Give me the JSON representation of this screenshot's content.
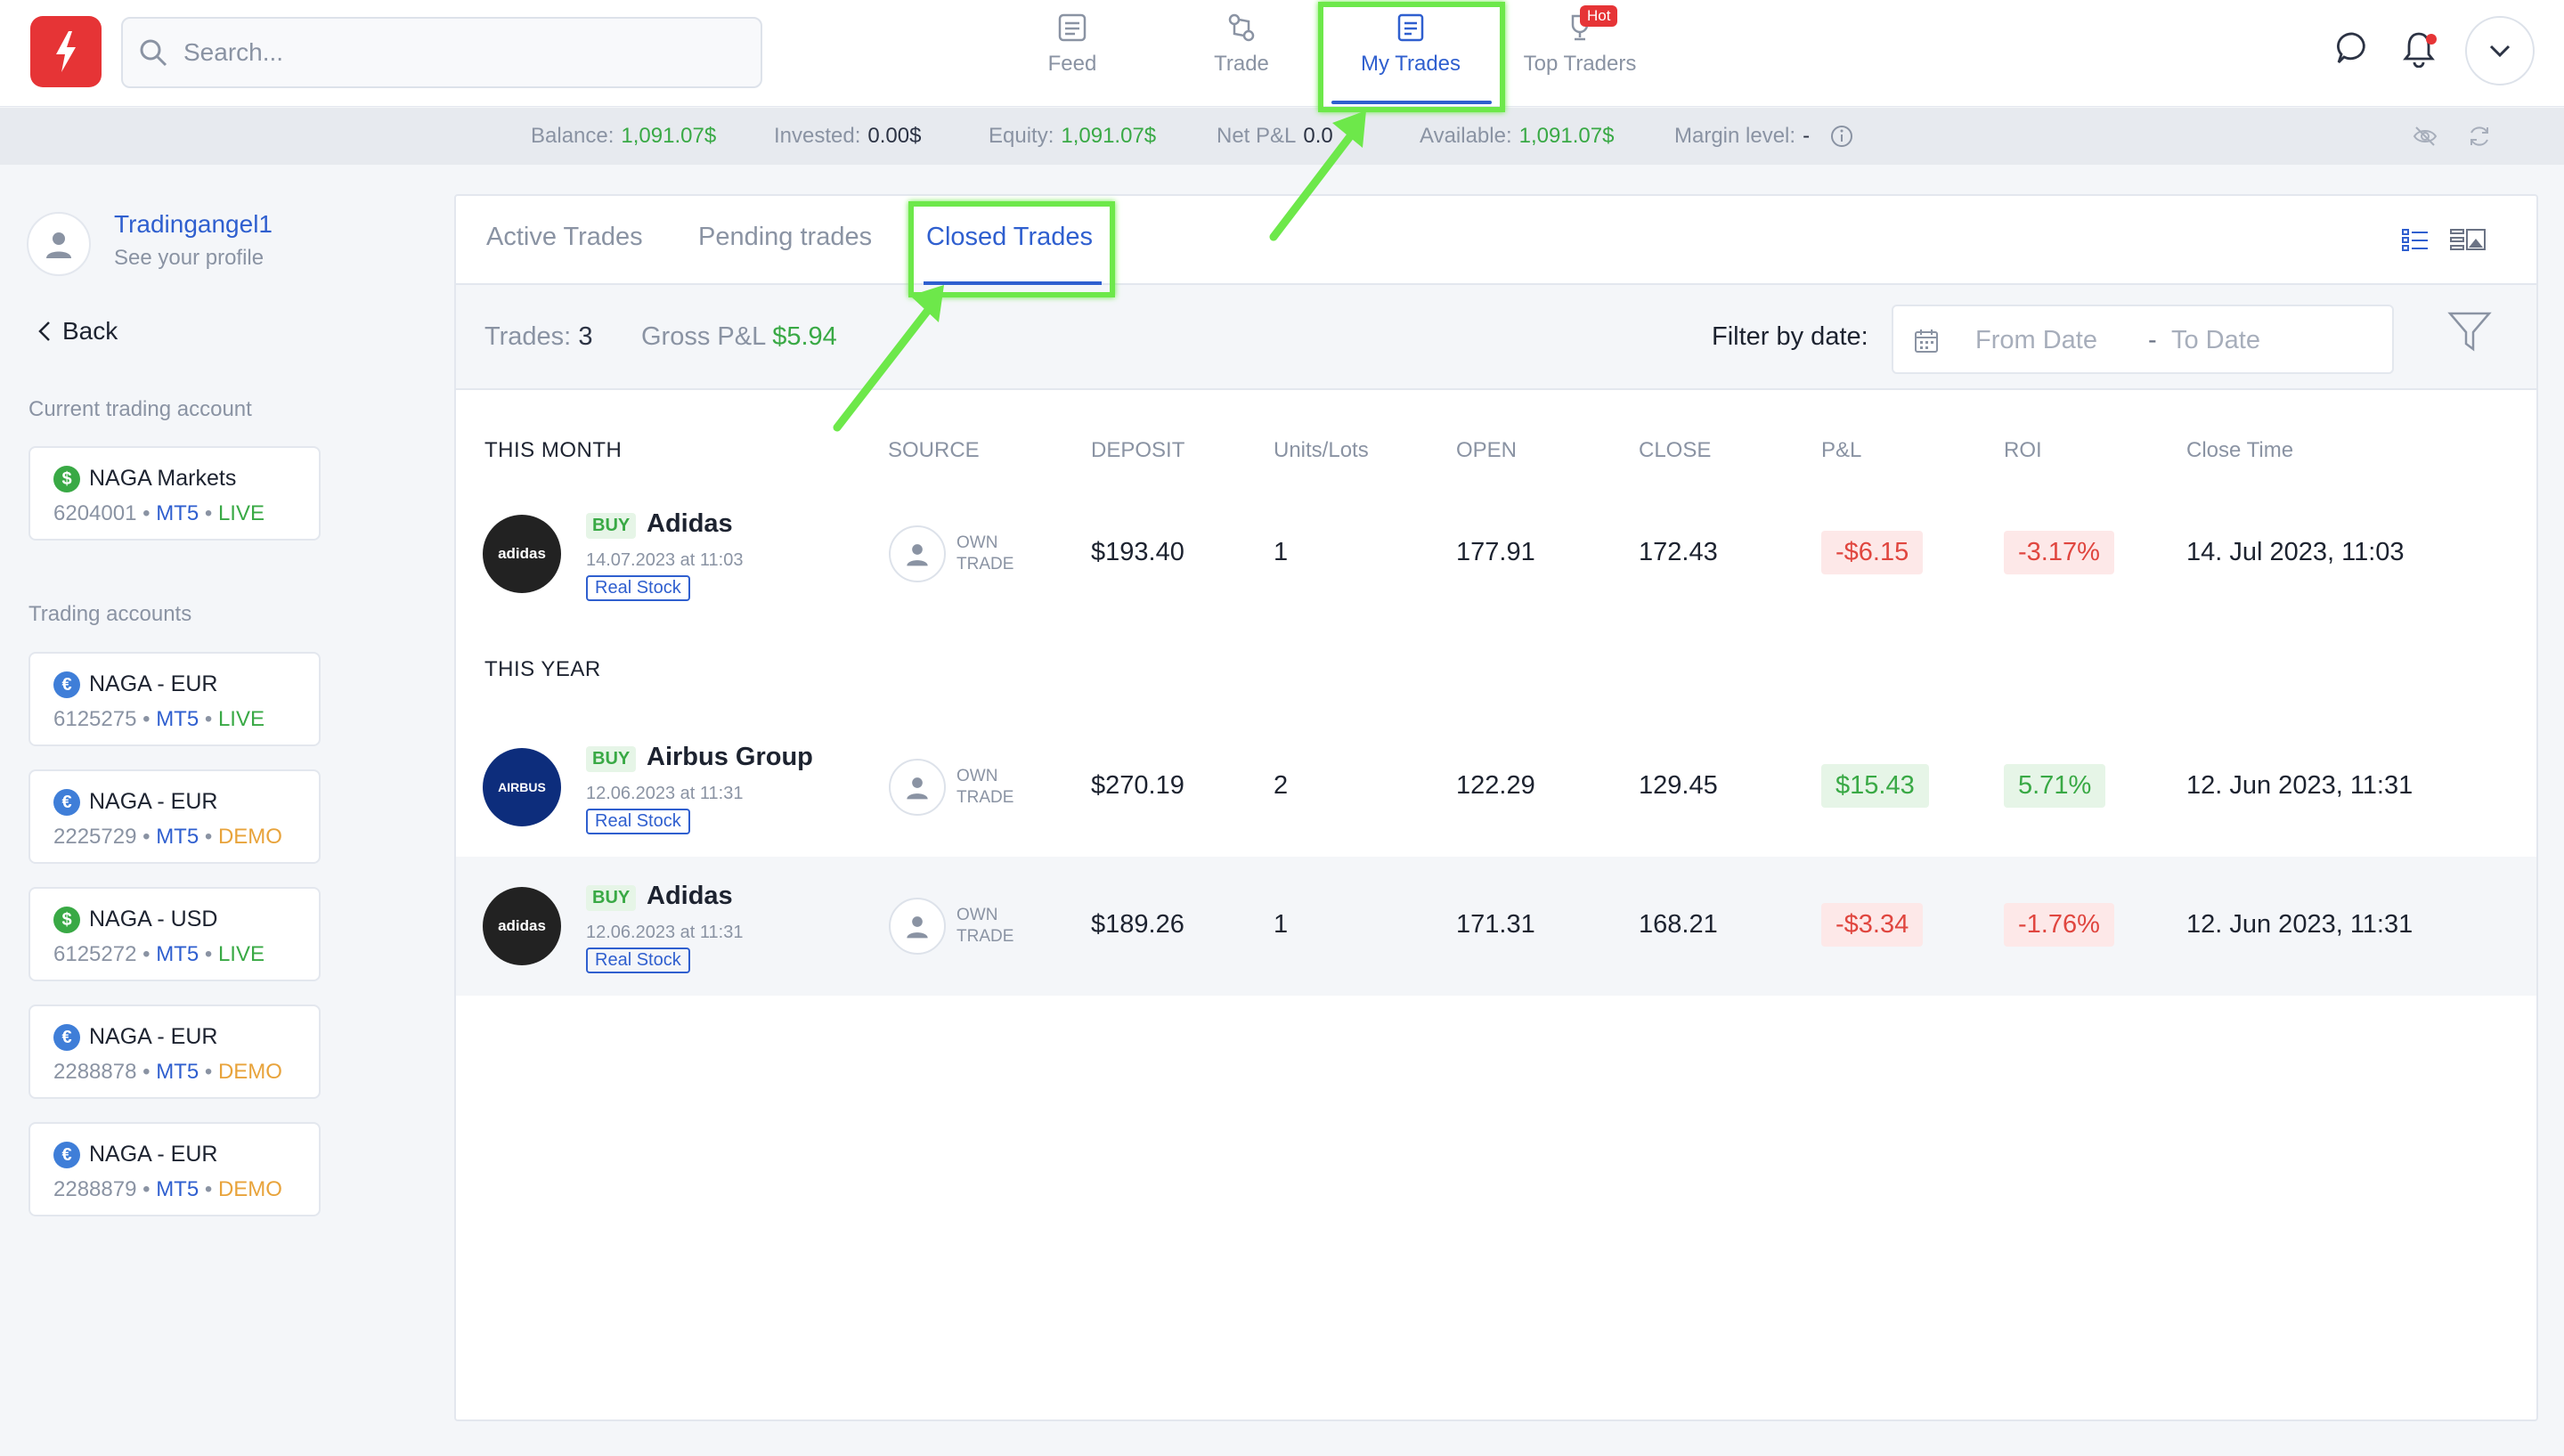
{
  "search": {
    "placeholder": "Search..."
  },
  "nav": {
    "items": [
      {
        "label": "Feed",
        "icon": "feed-icon"
      },
      {
        "label": "Trade",
        "icon": "trade-icon"
      },
      {
        "label": "My Trades",
        "icon": "my-trades-icon"
      },
      {
        "label": "Top Traders",
        "icon": "trophy-icon"
      }
    ],
    "active": "My Trades",
    "hot_badge": "Hot"
  },
  "stats": {
    "balance_label": "Balance:",
    "balance": "1,091.07$",
    "invested_label": "Invested:",
    "invested": "0.00$",
    "equity_label": "Equity:",
    "equity": "1,091.07$",
    "netpl_label": "Net P&L",
    "netpl": "0.0",
    "available_label": "Available:",
    "available": "1,091.07$",
    "margin_label": "Margin level:",
    "margin": "-"
  },
  "profile": {
    "name": "Tradingangel1",
    "subtitle": "See your profile"
  },
  "back_label": "Back",
  "current_account": {
    "title": "Current trading account",
    "name": "NAGA Markets",
    "number": "6204001",
    "platform": "MT5",
    "type": "LIVE",
    "currency_symbol": "$"
  },
  "accounts_title": "Trading accounts",
  "accounts": [
    {
      "name": "NAGA - EUR",
      "number": "6125275",
      "platform": "MT5",
      "type": "LIVE",
      "currency_symbol": "€"
    },
    {
      "name": "NAGA - EUR",
      "number": "2225729",
      "platform": "MT5",
      "type": "DEMO",
      "currency_symbol": "€"
    },
    {
      "name": "NAGA - USD",
      "number": "6125272",
      "platform": "MT5",
      "type": "LIVE",
      "currency_symbol": "$"
    },
    {
      "name": "NAGA - EUR",
      "number": "2288878",
      "platform": "MT5",
      "type": "DEMO",
      "currency_symbol": "€"
    },
    {
      "name": "NAGA - EUR",
      "number": "2288879",
      "platform": "MT5",
      "type": "DEMO",
      "currency_symbol": "€"
    }
  ],
  "tabs": {
    "active_trades": "Active Trades",
    "pending_trades": "Pending trades",
    "closed_trades": "Closed Trades"
  },
  "filter": {
    "trades_label": "Trades:",
    "trades_count": "3",
    "gross_label": "Gross P&L",
    "gross_value": "$5.94",
    "filter_label": "Filter by date:",
    "from_placeholder": "From Date",
    "separator": "-",
    "to_placeholder": "To Date"
  },
  "columns": {
    "this_month": "THIS MONTH",
    "source": "SOURCE",
    "deposit": "DEPOSIT",
    "units": "Units/Lots",
    "open": "OPEN",
    "close": "CLOSE",
    "pl": "P&L",
    "roi": "ROI",
    "close_time": "Close Time"
  },
  "this_year_label": "THIS YEAR",
  "trades": [
    {
      "brand_text": "adidas",
      "side": "BUY",
      "instrument": "Adidas",
      "date": "14.07.2023 at 11:03",
      "tag": "Real Stock",
      "source_line1": "OWN",
      "source_line2": "TRADE",
      "deposit": "$193.40",
      "units": "1",
      "open": "177.91",
      "close": "172.43",
      "pl": "-$6.15",
      "roi": "-3.17%",
      "close_time": "14. Jul 2023, 11:03",
      "positive": false
    },
    {
      "brand_text": "AIRBUS",
      "side": "BUY",
      "instrument": "Airbus Group",
      "date": "12.06.2023 at 11:31",
      "tag": "Real Stock",
      "source_line1": "OWN",
      "source_line2": "TRADE",
      "deposit": "$270.19",
      "units": "2",
      "open": "122.29",
      "close": "129.45",
      "pl": "$15.43",
      "roi": "5.71%",
      "close_time": "12. Jun 2023, 11:31",
      "positive": true
    },
    {
      "brand_text": "adidas",
      "side": "BUY",
      "instrument": "Adidas",
      "date": "12.06.2023 at 11:31",
      "tag": "Real Stock",
      "source_line1": "OWN",
      "source_line2": "TRADE",
      "deposit": "$189.26",
      "units": "1",
      "open": "171.31",
      "close": "168.21",
      "pl": "-$3.34",
      "roi": "-1.76%",
      "close_time": "12. Jun 2023, 11:31",
      "positive": false
    }
  ],
  "colors": {
    "accent": "#2f5fcf",
    "positive": "#39a945",
    "negative": "#e0463f",
    "brand_red": "#e63436",
    "demo": "#e8a33b",
    "annotation": "#6de84a"
  }
}
